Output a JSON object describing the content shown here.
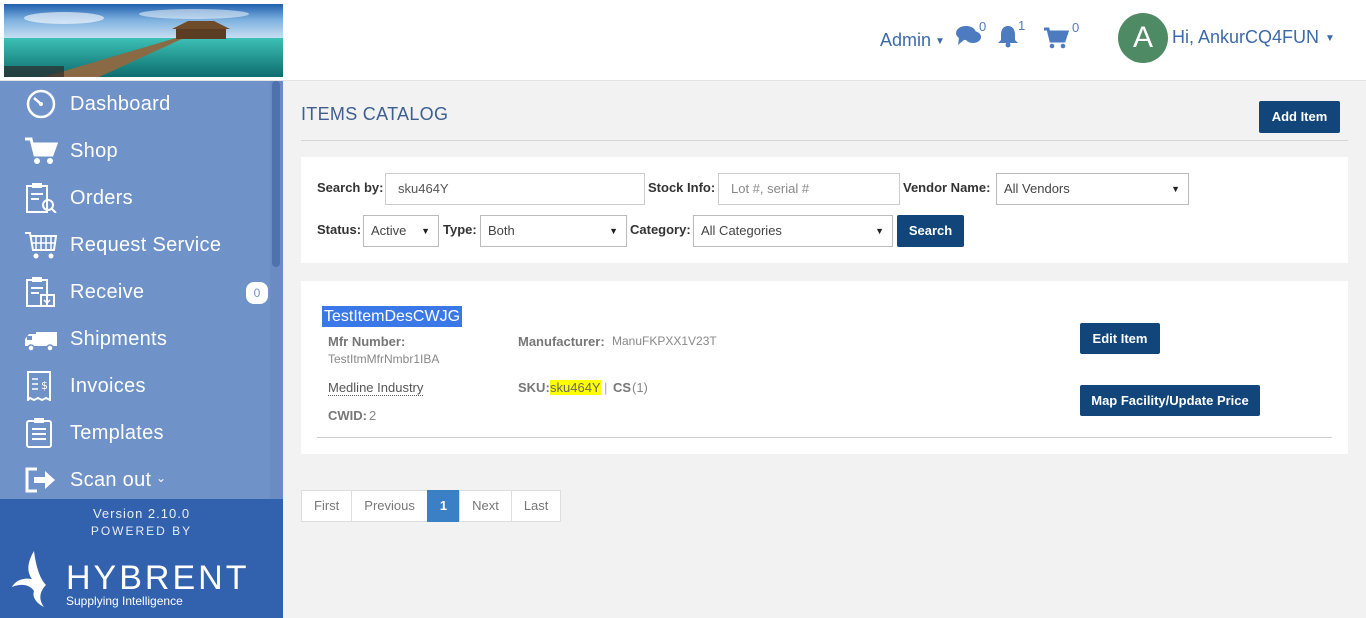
{
  "header": {
    "admin_label": "Admin",
    "messages_count": "0",
    "notifications_count": "1",
    "cart_count": "0",
    "avatar_letter": "A",
    "greeting": "Hi, AnkurCQ4FUN"
  },
  "sidebar": {
    "items": [
      {
        "label": "Dashboard",
        "icon": "dashboard-gauge-icon"
      },
      {
        "label": "Shop",
        "icon": "cart-icon"
      },
      {
        "label": "Orders",
        "icon": "orders-clipboard-icon"
      },
      {
        "label": "Request Service",
        "icon": "service-cart-icon"
      },
      {
        "label": "Receive",
        "icon": "receive-icon",
        "badge": "0"
      },
      {
        "label": "Shipments",
        "icon": "truck-icon"
      },
      {
        "label": "Invoices",
        "icon": "invoice-icon"
      },
      {
        "label": "Templates",
        "icon": "templates-icon"
      },
      {
        "label": "Scan out",
        "icon": "scan-out-icon"
      }
    ],
    "version": "Version 2.10.0",
    "powered_by": "POWERED BY",
    "brand": "HYBRENT",
    "tagline": "Supplying Intelligence"
  },
  "main": {
    "title": "ITEMS CATALOG",
    "add_item_label": "Add Item",
    "filters": {
      "search_by_label": "Search by:",
      "search_by_value": "sku464Y",
      "stock_info_label": "Stock Info:",
      "stock_info_placeholder": "Lot #, serial #",
      "vendor_label": "Vendor Name:",
      "vendor_value": "All Vendors",
      "status_label": "Status:",
      "status_value": "Active",
      "type_label": "Type:",
      "type_value": "Both",
      "category_label": "Category:",
      "category_value": "All Categories",
      "search_button": "Search"
    },
    "result": {
      "title": "TestItemDesCWJG",
      "mfr_number_label": "Mfr Number:",
      "mfr_number_value": "TestItmMfrNmbr1IBA",
      "manufacturer_label": "Manufacturer:",
      "manufacturer_value": "ManuFKPXX1V23T",
      "vendor": "Medline Industry",
      "sku_label": "SKU:",
      "sku_value": "sku464Y",
      "sku_sep": "|",
      "uom_label": "CS",
      "uom_value": "(1)",
      "cwid_label": "CWID:",
      "cwid_value": "2",
      "edit_button": "Edit Item",
      "map_button": "Map Facility/Update Price"
    },
    "pagination": {
      "first": "First",
      "previous": "Previous",
      "current": "1",
      "next": "Next",
      "last": "Last"
    }
  },
  "colors": {
    "sidebar": "#6f92c9",
    "sidebar_footer": "#3261ad",
    "primary_button": "#12457a",
    "link": "#3d6aa8",
    "highlight": "#ffff00"
  }
}
